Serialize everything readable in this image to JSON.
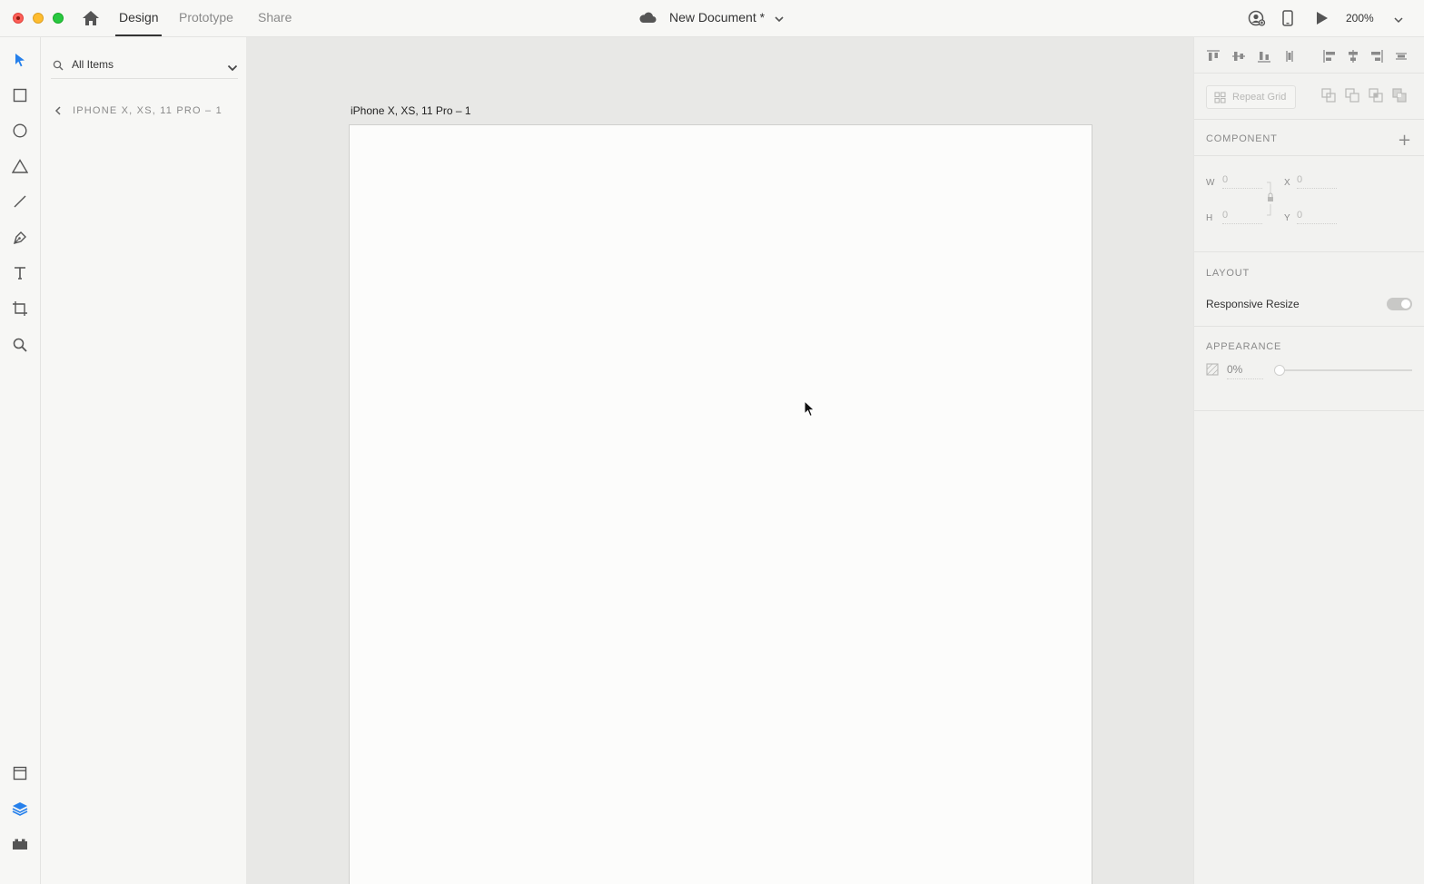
{
  "window": {
    "mode_tabs": {
      "design": "Design",
      "prototype": "Prototype",
      "share": "Share"
    },
    "active_tab": "design",
    "document_title": "New Document *",
    "zoom_level": "200%"
  },
  "left_panel": {
    "search": {
      "value": "All Items"
    },
    "breadcrumb": "IPHONE X, XS, 11 PRO – 1"
  },
  "canvas": {
    "artboard_name": "iPhone X, XS, 11 Pro – 1"
  },
  "inspector": {
    "repeat_grid_label": "Repeat Grid",
    "component_title": "COMPONENT",
    "add_symbol": "+",
    "dimensions": {
      "w_label": "W",
      "w_value": "0",
      "h_label": "H",
      "h_value": "0",
      "x_label": "X",
      "x_value": "0",
      "y_label": "Y",
      "y_value": "0"
    },
    "layout_title": "LAYOUT",
    "responsive_resize_label": "Responsive Resize",
    "responsive_resize_on": true,
    "appearance_title": "APPEARANCE",
    "opacity_value": "0%",
    "opacity_level": 0
  },
  "colors": {
    "accent": "#2680eb",
    "chrome_bg": "#f7f7f5",
    "canvas_bg": "#e8e8e6",
    "artboard_bg": "#fcfcfb"
  },
  "icons": {
    "toolbar": [
      "home-icon",
      "cloud-icon",
      "chevron-down-icon",
      "share-user-icon",
      "mobile-device-icon",
      "play-icon"
    ],
    "tools": [
      "select-icon",
      "rectangle-icon",
      "ellipse-icon",
      "polygon-icon",
      "line-icon",
      "pen-icon",
      "text-icon",
      "artboard-icon",
      "zoom-icon"
    ],
    "panels": [
      "assets-icon",
      "layers-icon",
      "plugins-icon"
    ]
  }
}
